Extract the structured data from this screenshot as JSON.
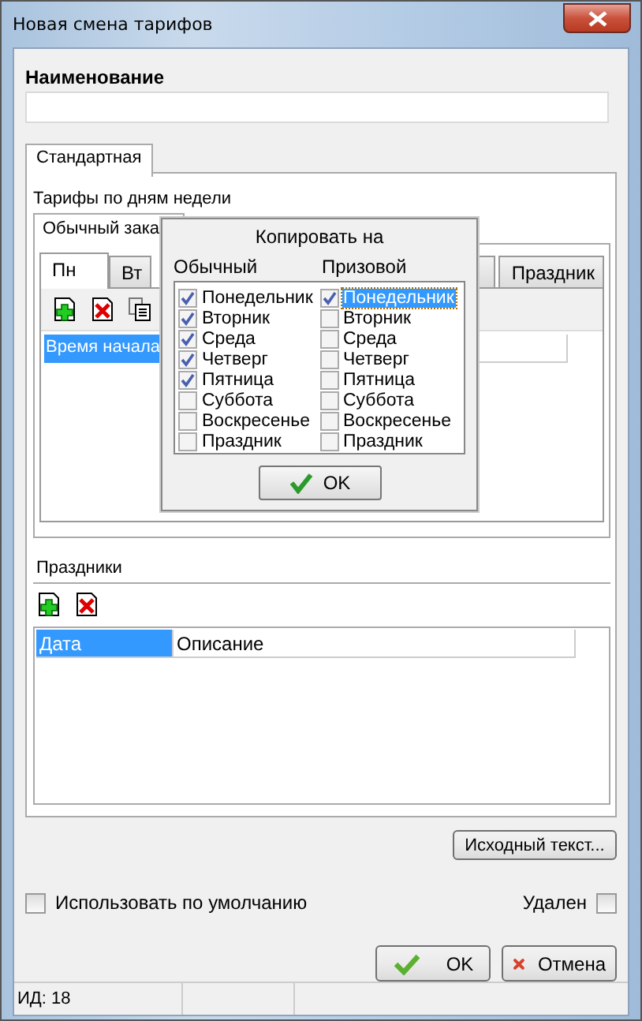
{
  "window": {
    "title": "Новая смена тарифов"
  },
  "name_field": {
    "label": "Наименование"
  },
  "outer_tabs": [
    {
      "label": "Стандартная",
      "selected": true
    }
  ],
  "weekday_section": {
    "title": "Тарифы по дням недели",
    "mode_tabs": [
      {
        "label": "Обычный зака",
        "selected": true
      }
    ],
    "day_tabs": [
      {
        "label": "Пн",
        "selected": true
      },
      {
        "label": "Вт",
        "selected": false
      },
      {
        "label": "Праздник",
        "selected": false
      }
    ],
    "grid_cells": [
      {
        "text": "Время начала",
        "selected": true
      }
    ]
  },
  "copy_popup": {
    "title": "Копировать на",
    "columns": [
      "Обычный",
      "Призовой"
    ],
    "regular": [
      {
        "label": "Понедельник",
        "checked": true,
        "selected": false
      },
      {
        "label": "Вторник",
        "checked": true,
        "selected": false
      },
      {
        "label": "Среда",
        "checked": true,
        "selected": false
      },
      {
        "label": "Четверг",
        "checked": true,
        "selected": false
      },
      {
        "label": "Пятница",
        "checked": true,
        "selected": false
      },
      {
        "label": "Суббота",
        "checked": false,
        "selected": false
      },
      {
        "label": "Воскресенье",
        "checked": false,
        "selected": false
      },
      {
        "label": "Праздник",
        "checked": false,
        "selected": false
      }
    ],
    "prize": [
      {
        "label": "Понедельник",
        "checked": true,
        "selected": true
      },
      {
        "label": "Вторник",
        "checked": false,
        "selected": false
      },
      {
        "label": "Среда",
        "checked": false,
        "selected": false
      },
      {
        "label": "Четверг",
        "checked": false,
        "selected": false
      },
      {
        "label": "Пятница",
        "checked": false,
        "selected": false
      },
      {
        "label": "Суббота",
        "checked": false,
        "selected": false
      },
      {
        "label": "Воскресенье",
        "checked": false,
        "selected": false
      },
      {
        "label": "Праздник",
        "checked": false,
        "selected": false
      }
    ],
    "ok_button": "OK"
  },
  "holidays": {
    "title": "Праздники",
    "columns": [
      {
        "label": "Дата",
        "selected": true
      },
      {
        "label": "Описание",
        "selected": false
      }
    ]
  },
  "source_button": "Исходный текст...",
  "use_default": {
    "label": "Использовать по умолчанию",
    "checked": false
  },
  "deleted": {
    "label": "Удален",
    "checked": false
  },
  "buttons": [
    {
      "kind": "ok",
      "label": "OK"
    },
    {
      "kind": "cancel",
      "label": "Отмена"
    }
  ],
  "status_bar": [
    "ИД: 18"
  ]
}
